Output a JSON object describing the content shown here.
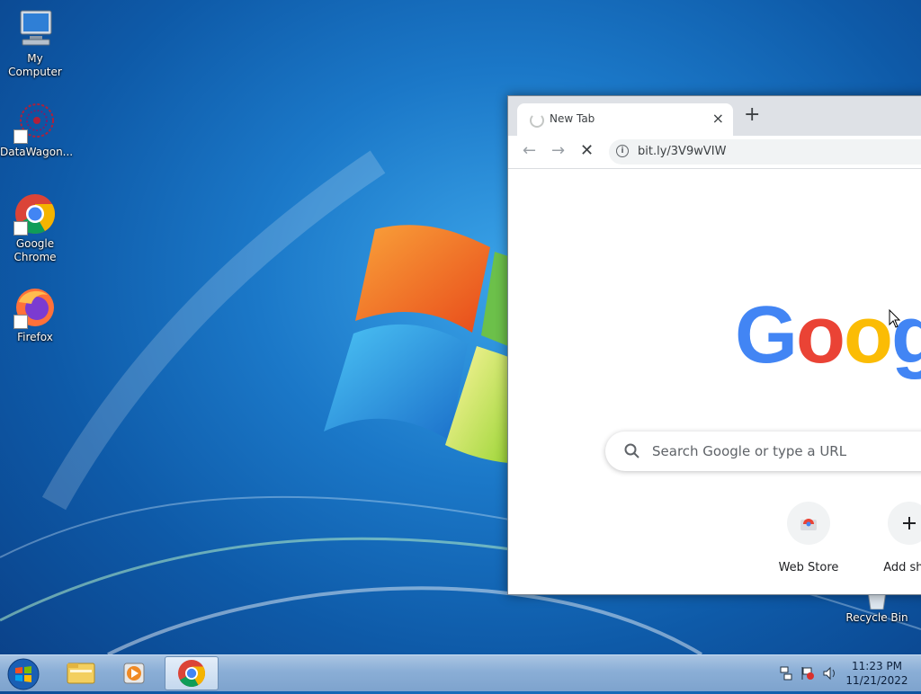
{
  "desktop": {
    "icons": [
      {
        "label": "My Computer"
      },
      {
        "label": "DataWagon..."
      },
      {
        "label": "Google Chrome"
      },
      {
        "label": "Firefox"
      },
      {
        "label": "Recycle Bin"
      }
    ]
  },
  "browser": {
    "tab": {
      "title": "New Tab",
      "close_glyph": "×"
    },
    "new_tab_glyph": "+",
    "toolbar": {
      "back_glyph": "←",
      "forward_glyph": "→",
      "stop_glyph": "✕",
      "info_glyph": "i"
    },
    "omnibox": {
      "url": "bit.ly/3V9wVIW"
    },
    "ntp": {
      "logo": "Goog",
      "search_placeholder": "Search Google or type a URL",
      "shortcuts": [
        {
          "label": "Web Store",
          "icon": "web-store-icon"
        },
        {
          "label": "Add shor",
          "icon": "plus-icon"
        }
      ]
    }
  },
  "taskbar": {
    "pinned": [
      "start-orb-icon",
      "explorer-icon",
      "media-player-icon",
      "chrome-icon"
    ],
    "clock": {
      "time": "11:23 PM",
      "date": "11/21/2022"
    }
  },
  "colors": {
    "google_blue": "#4285f4",
    "google_red": "#ea4335",
    "google_yellow": "#fbbc05",
    "google_green": "#34a853"
  }
}
